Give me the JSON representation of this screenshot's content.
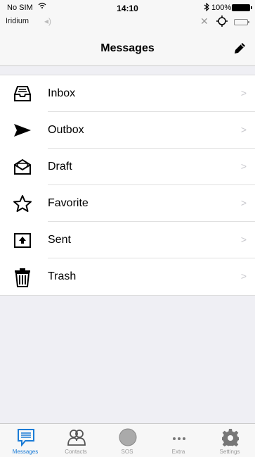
{
  "status_bar": {
    "carrier": "No SIM",
    "time": "14:10",
    "battery": "100%"
  },
  "iridium_bar": {
    "label": "Iridium"
  },
  "nav": {
    "title": "Messages"
  },
  "folders": [
    {
      "label": "Inbox",
      "icon": "inbox-icon"
    },
    {
      "label": "Outbox",
      "icon": "send-arrow-icon"
    },
    {
      "label": "Draft",
      "icon": "draft-envelope-icon"
    },
    {
      "label": "Favorite",
      "icon": "star-icon"
    },
    {
      "label": "Sent",
      "icon": "upload-box-icon"
    },
    {
      "label": "Trash",
      "icon": "trash-icon"
    }
  ],
  "tabs": [
    {
      "label": "Messages",
      "icon": "message-icon",
      "active": true
    },
    {
      "label": "Contacts",
      "icon": "contacts-icon",
      "active": false
    },
    {
      "label": "SOS",
      "icon": "sos-circle-icon",
      "active": false
    },
    {
      "label": "Extra",
      "icon": "more-dots-icon",
      "active": false
    },
    {
      "label": "Settings",
      "icon": "gear-icon",
      "active": false
    }
  ],
  "colors": {
    "accent": "#1a7bd6",
    "inactive": "#999999",
    "background": "#efeff4"
  }
}
